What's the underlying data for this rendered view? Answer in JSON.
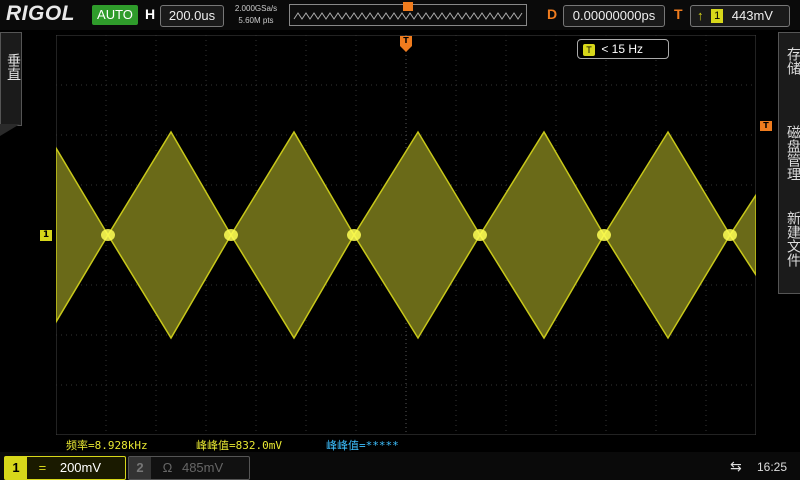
{
  "header": {
    "brand": "RIGOL",
    "run_mode": "AUTO",
    "horizontal_label": "H",
    "timebase": "200.0us",
    "sample_rate": "2.000GSa/s",
    "memory_depth": "5.60M pts",
    "delay_label": "D",
    "delay_value": "0.00000000ps",
    "trigger_label": "T",
    "trigger_source": "1",
    "trigger_level": "443mV"
  },
  "left_panel": {
    "label": "垂直"
  },
  "right_panel": {
    "items": [
      "存储",
      "磁盘管理",
      "新建文件"
    ]
  },
  "markers": {
    "trigger_box_icon": "T",
    "trigger_freq": "< 15 Hz",
    "ch1_marker": "1",
    "trigger_level_marker": "T",
    "top_trigger_marker": "T"
  },
  "measurements": [
    {
      "label": "频率=8.928kHz",
      "color": "#e8e832"
    },
    {
      "label": "峰峰值=832.0mV",
      "color": "#e8e832"
    },
    {
      "label": "峰峰值=*****",
      "color": "#3ec0ff"
    }
  ],
  "channels": [
    {
      "number": "1",
      "coupling": "=",
      "scale": "200mV",
      "active": true
    },
    {
      "number": "2",
      "coupling": "Ω",
      "scale": "485mV",
      "active": false
    }
  ],
  "status": {
    "usb_icon": "usb-icon",
    "time": "16:25"
  },
  "colors": {
    "ch1": "#d7d71a",
    "trigger": "#f07c1e",
    "auto": "#2f9c2b",
    "measure_alt": "#3ec0ff"
  }
}
